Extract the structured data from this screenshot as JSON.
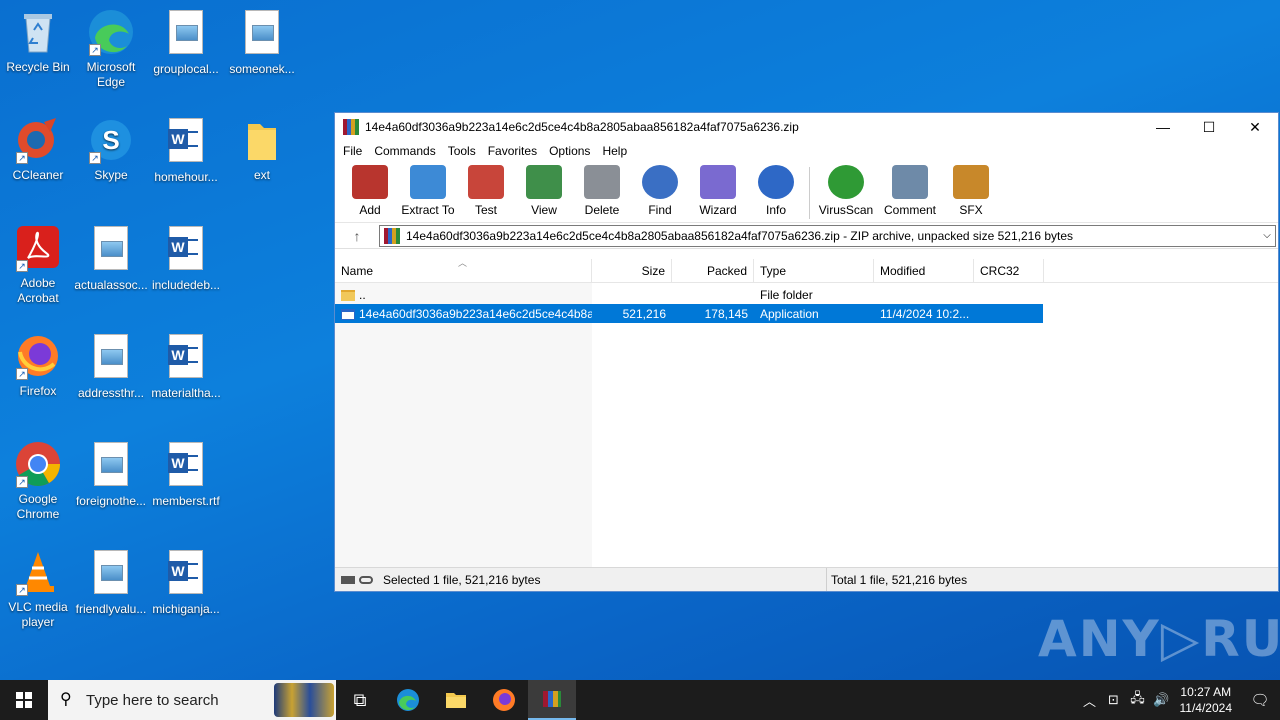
{
  "desktop": {
    "icons": [
      {
        "label": "Recycle Bin"
      },
      {
        "label": "Microsoft Edge"
      },
      {
        "label": "grouplocal..."
      },
      {
        "label": "someonek..."
      },
      {
        "label": "CCleaner"
      },
      {
        "label": "Skype"
      },
      {
        "label": "homehour..."
      },
      {
        "label": "ext"
      },
      {
        "label": "Adobe Acrobat"
      },
      {
        "label": "actualassoc..."
      },
      {
        "label": "includedeb..."
      },
      {
        "label": "Firefox"
      },
      {
        "label": "addressthr..."
      },
      {
        "label": "materialtha..."
      },
      {
        "label": "Google Chrome"
      },
      {
        "label": "foreignothe..."
      },
      {
        "label": "memberst.rtf"
      },
      {
        "label": "VLC media player"
      },
      {
        "label": "friendlyvalu..."
      },
      {
        "label": "michiganja..."
      }
    ]
  },
  "window": {
    "title": "14e4a60df3036a9b223a14e6c2d5ce4c4b8a2805abaa856182a4faf7075a6236.zip",
    "minimize": "—",
    "maximize": "☐",
    "close": "✕",
    "menu": [
      "File",
      "Commands",
      "Tools",
      "Favorites",
      "Options",
      "Help"
    ],
    "toolbar": [
      {
        "label": "Add",
        "color": "#b8352e"
      },
      {
        "label": "Extract To",
        "color": "#3d8ad6"
      },
      {
        "label": "Test",
        "color": "#c8453a"
      },
      {
        "label": "View",
        "color": "#3f8f4a"
      },
      {
        "label": "Delete",
        "color": "#8a8f96"
      },
      {
        "label": "Find",
        "color": "#3a6fc4"
      },
      {
        "label": "Wizard",
        "color": "#7a6ad0"
      },
      {
        "label": "Info",
        "color": "#2e68c6"
      },
      {
        "label": "VirusScan",
        "color": "#2f9a35"
      },
      {
        "label": "Comment",
        "color": "#6e8aa8"
      },
      {
        "label": "SFX",
        "color": "#c8882a"
      }
    ],
    "address": "14e4a60df3036a9b223a14e6c2d5ce4c4b8a2805abaa856182a4faf7075a6236.zip - ZIP archive, unpacked size 521,216 bytes",
    "columns": {
      "name": "Name",
      "size": "Size",
      "packed": "Packed",
      "type": "Type",
      "modified": "Modified",
      "crc": "CRC32"
    },
    "rows": [
      {
        "name": "..",
        "size": "",
        "packed": "",
        "type": "File folder",
        "modified": "",
        "crc": ""
      },
      {
        "name": "14e4a60df3036a9b223a14e6c2d5ce4c4b8a...",
        "size": "521,216",
        "packed": "178,145",
        "type": "Application",
        "modified": "11/4/2024 10:2...",
        "crc": ""
      }
    ],
    "status_left": "Selected 1 file, 521,216 bytes",
    "status_right": "Total 1 file, 521,216 bytes"
  },
  "watermark": "ANY▷RUN",
  "taskbar": {
    "search_placeholder": "Type here to search",
    "time": "10:27 AM",
    "date": "11/4/2024"
  }
}
